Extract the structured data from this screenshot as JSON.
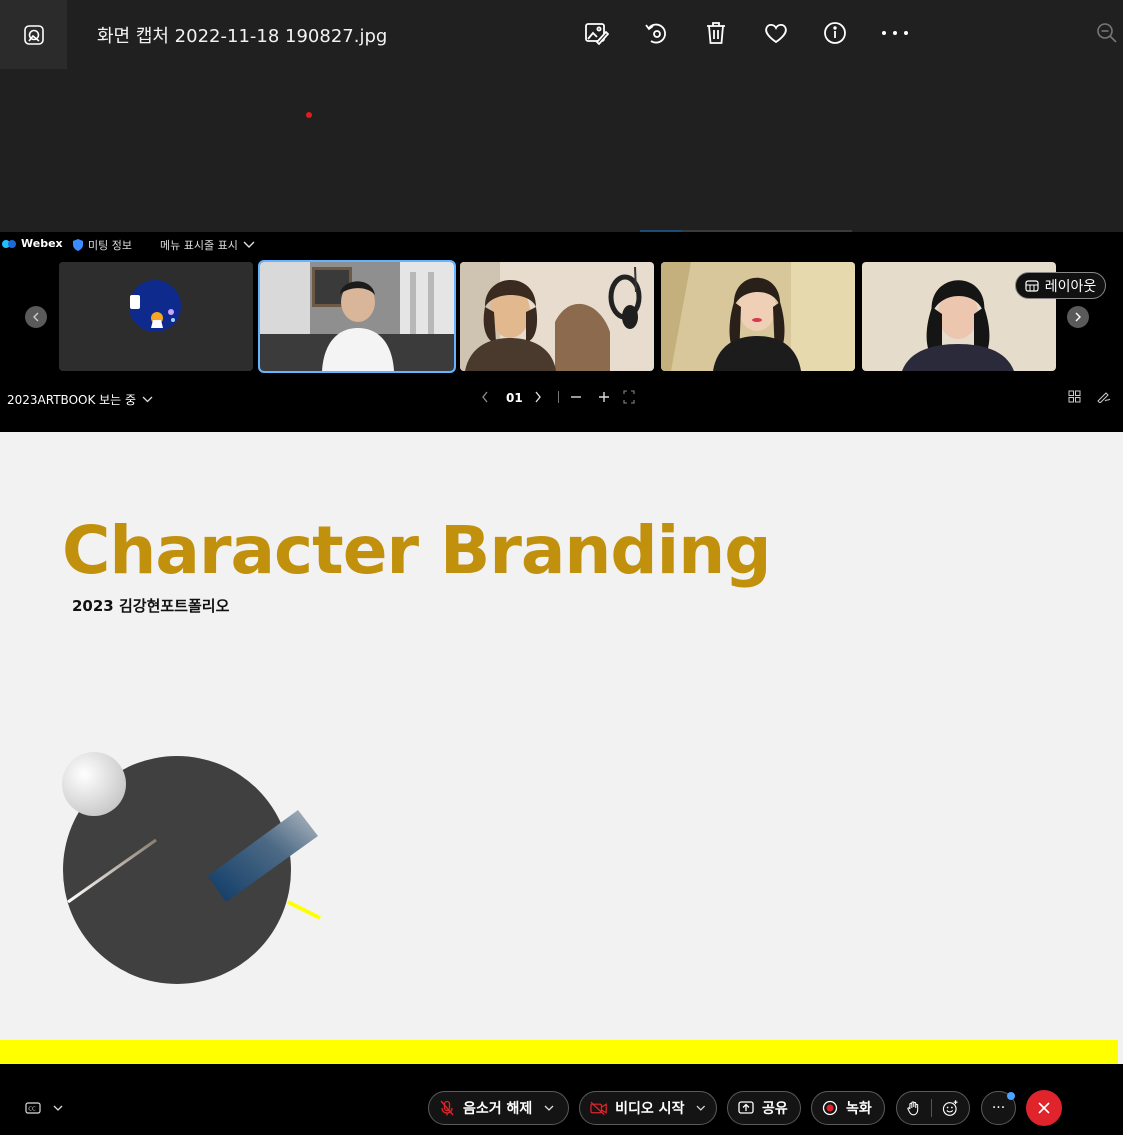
{
  "viewer": {
    "file_title": "화면 캡처 2022-11-18 190827.jpg",
    "toolbar": [
      "edit-image-icon",
      "rotate-icon",
      "delete-icon",
      "favorite-icon",
      "info-icon",
      "more-icon",
      "zoom-out-icon"
    ],
    "progress": 0.2
  },
  "webex": {
    "app_name": "Webex",
    "meeting_info": "미팅 정보",
    "menu_bar_toggle": "메뉴 표시줄 표시",
    "layout_button": "레이아웃",
    "sharing_label": "2023ARTBOOK 보는 중",
    "page_number": "01",
    "colors": {
      "accent": "#64b4ff",
      "end_call": "#e0242c",
      "slide_title": "#c1900c",
      "slide_bar": "#ffff00"
    }
  },
  "slide": {
    "title": "Character Branding",
    "subtitle": "2023 김강현포트폴리오"
  },
  "controls": {
    "unmute": "음소거 해제",
    "start_video": "비디오 시작",
    "share": "공유",
    "record": "녹화",
    "more": "···"
  }
}
